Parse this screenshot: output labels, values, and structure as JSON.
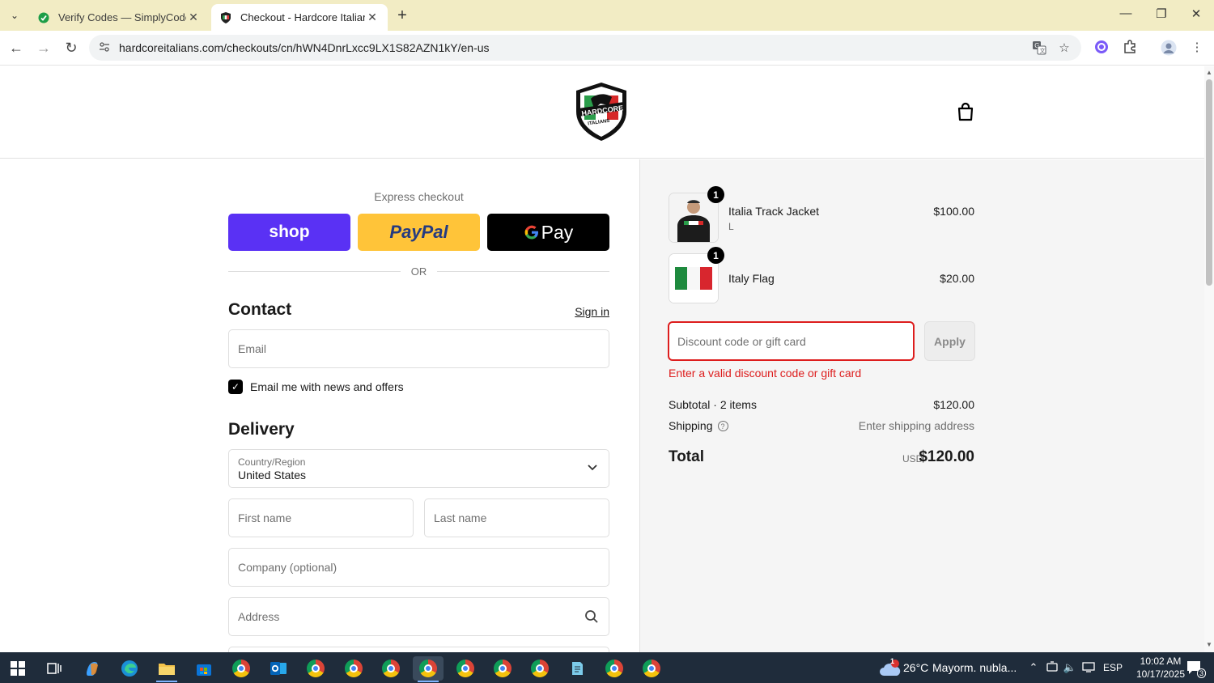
{
  "browser": {
    "tabs": [
      {
        "title": "Verify Codes — SimplyCodes",
        "active": false
      },
      {
        "title": "Checkout - Hardcore Italians",
        "active": true
      }
    ],
    "url": "hardcoreitalians.com/checkouts/cn/hWN4DnrLxcc9LX1S82AZN1kY/en-us"
  },
  "express": {
    "title": "Express checkout",
    "shop_label": "shop",
    "paypal_label": "PayPal",
    "gpay_label": "G Pay",
    "or_label": "OR"
  },
  "contact": {
    "heading": "Contact",
    "signin": "Sign in",
    "email_placeholder": "Email",
    "newsletter_label": "Email me with news and offers",
    "newsletter_checked": true
  },
  "delivery": {
    "heading": "Delivery",
    "country_label": "Country/Region",
    "country_value": "United States",
    "first_name_placeholder": "First name",
    "last_name_placeholder": "Last name",
    "company_placeholder": "Company (optional)",
    "address_placeholder": "Address"
  },
  "order": {
    "items": [
      {
        "name": "Italia Track Jacket",
        "variant": "L",
        "price": "$100.00",
        "qty": "1"
      },
      {
        "name": "Italy Flag",
        "variant": "",
        "price": "$20.00",
        "qty": "1"
      }
    ],
    "discount_placeholder": "Discount code or gift card",
    "apply_label": "Apply",
    "error": "Enter a valid discount code or gift card",
    "subtotal_label": "Subtotal · 2 items",
    "subtotal_value": "$120.00",
    "shipping_label": "Shipping",
    "shipping_value": "Enter shipping address",
    "total_label": "Total",
    "currency": "USD",
    "total_value": "$120.00"
  },
  "taskbar": {
    "weather_temp": "26°C",
    "weather_text": "Mayorm. nubla...",
    "weather_badge": "1",
    "language": "ESP",
    "time": "10:02 AM",
    "date": "10/17/2025",
    "notifications": "3"
  },
  "colors": {
    "shop_purple": "#5a31f4",
    "paypal_yellow": "#ffc439",
    "error_red": "#dd1d1d",
    "tabbar": "#f2ecc4"
  }
}
